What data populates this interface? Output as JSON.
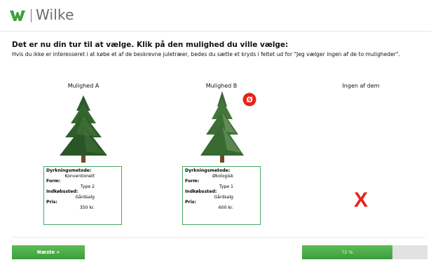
{
  "brand": {
    "name": "Wilke",
    "accent": "#3fa13a"
  },
  "heading": "Det er nu din tur til at vælge. Klik på den mulighed du ville vælge:",
  "instructions": "Hvis du ikke er interesseret i at købe et af de beskrevne juletræer, bedes du sætte et kryds i feltet ud for \"Jeg vælger ingen af de to muligheder\".",
  "options": [
    {
      "title": "Mulighed A",
      "eco_badge": false,
      "attributes": [
        {
          "label": "Dyrkningsmetode:",
          "value": "Konventionelt"
        },
        {
          "label": "Form:",
          "value": "Type 2"
        },
        {
          "label": "Indkøbssted:",
          "value": "Gårdsalg"
        },
        {
          "label": "Pris:",
          "value": "350 kr."
        }
      ]
    },
    {
      "title": "Mulighed B",
      "eco_badge": true,
      "attributes": [
        {
          "label": "Dyrkningsmetode:",
          "value": "Økologisk"
        },
        {
          "label": "Form:",
          "value": "Type 1"
        },
        {
          "label": "Indkøbssted:",
          "value": "Gårdsalg"
        },
        {
          "label": "Pris:",
          "value": "600 kr."
        }
      ]
    }
  ],
  "none_option": {
    "title": "Ingen af dem",
    "mark": "X",
    "mark_color": "#e8231b"
  },
  "navigation": {
    "next_label": "Næste »"
  },
  "progress": {
    "percent": 72,
    "label": "72 %"
  }
}
